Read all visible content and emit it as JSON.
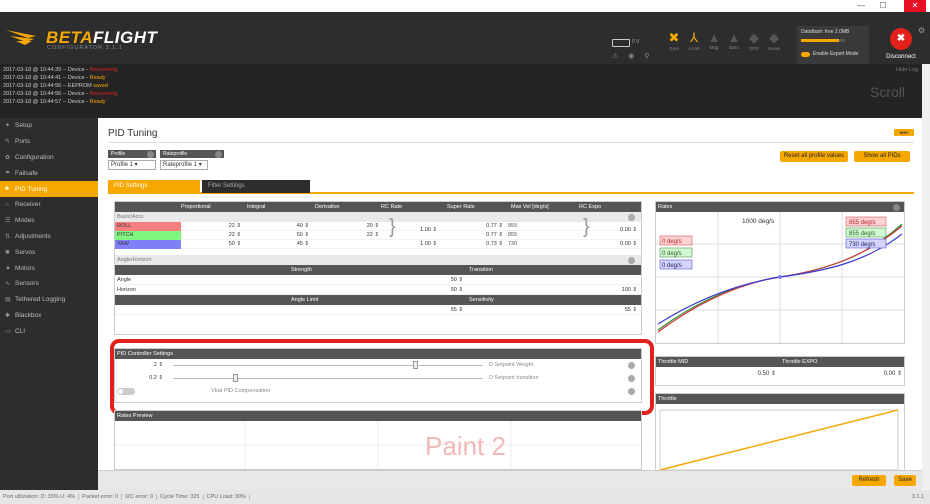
{
  "window": {
    "minimize": "—",
    "maximize": "☐",
    "close": "✕"
  },
  "header": {
    "logo_betaflight": "BETA",
    "logo_flight": "FLIGHT",
    "logo_sub": "CONFIGURATOR 3.1.1",
    "battery": "0 V",
    "sensors": [
      {
        "name": "Gyro",
        "glyph": "✖",
        "on": true
      },
      {
        "name": "Accel",
        "glyph": "⅄",
        "on": true
      },
      {
        "name": "Mag",
        "glyph": "▲",
        "on": false
      },
      {
        "name": "Baro",
        "glyph": "▲",
        "on": false
      },
      {
        "name": "GPS",
        "glyph": "◆",
        "on": false
      },
      {
        "name": "Sonar",
        "glyph": "◆",
        "on": false
      }
    ],
    "dataflash": "Dataflash: free 2.0MB",
    "dataflash_fraction": 0.86,
    "expert_mode": "Enable Expert Mode",
    "disconnect": "Disconnect"
  },
  "log": {
    "lines": [
      {
        "prefix": "2017-03-18 @ 10:44:39 -- Device - ",
        "status": "Recovering",
        "tone": "red"
      },
      {
        "prefix": "2017-03-18 @ 10:44:41 -- Device - ",
        "status": "Ready",
        "tone": "yellow"
      },
      {
        "prefix": "2017-03-18 @ 10:44:56 -- EEPROM ",
        "status": "saved",
        "tone": "yellow"
      },
      {
        "prefix": "2017-03-18 @ 10:44:56 -- Device - ",
        "status": "Recovering",
        "tone": "red"
      },
      {
        "prefix": "2017-03-18 @ 10:44:57 -- Device - ",
        "status": "Ready",
        "tone": "yellow"
      }
    ],
    "hide_log": "Hide Log",
    "scroll": "Scroll"
  },
  "nav": [
    {
      "label": "Setup",
      "icon": "✦",
      "active": false
    },
    {
      "label": "Ports",
      "icon": "✎",
      "active": false
    },
    {
      "label": "Configuration",
      "icon": "✿",
      "active": false
    },
    {
      "label": "Failsafe",
      "icon": "☂",
      "active": false
    },
    {
      "label": "PID Tuning",
      "icon": "♣",
      "active": true
    },
    {
      "label": "Receiver",
      "icon": "⌂",
      "active": false
    },
    {
      "label": "Modes",
      "icon": "☰",
      "active": false
    },
    {
      "label": "Adjustments",
      "icon": "⇅",
      "active": false
    },
    {
      "label": "Servos",
      "icon": "✺",
      "active": false
    },
    {
      "label": "Motors",
      "icon": "▲",
      "active": false
    },
    {
      "label": "Sensors",
      "icon": "∿",
      "active": false
    },
    {
      "label": "Tethered Logging",
      "icon": "▤",
      "active": false
    },
    {
      "label": "Blackbox",
      "icon": "✱",
      "active": false
    },
    {
      "label": "CLI",
      "icon": "▭",
      "active": false
    }
  ],
  "page": {
    "title": "PID Tuning",
    "wiki": "WIKI",
    "profile_label": "Profile",
    "profile_value": "Profile 1",
    "rateprofile_label": "Rateprofile",
    "rateprofile_value": "Rateprofile 1",
    "reset_button": "Reset all profile values",
    "show_all_button": "Show all PIDs",
    "tabs": [
      "PID Settings",
      "Filter Settings"
    ]
  },
  "pid_table": {
    "headers": [
      "Proportional",
      "Integral",
      "Derivative",
      "RC Rate",
      "Super Rate",
      "Max Vel [deg/s]",
      "RC Expo"
    ],
    "group_basic": "Basic/Acro",
    "rows": [
      {
        "axis": "ROLL",
        "color": "#f77f7f",
        "p": "22",
        "i": "40",
        "d": "20",
        "super": "0.77",
        "maxvel": "855"
      },
      {
        "axis": "PITCH",
        "color": "#7ff77f",
        "p": "22",
        "i": "50",
        "d": "22",
        "super": "0.77",
        "maxvel": "855"
      },
      {
        "axis": "YAW",
        "color": "#7f7ff7",
        "p": "50",
        "i": "45",
        "d": "",
        "super": "0.73",
        "maxvel": "730"
      }
    ],
    "rc_rate": "1.00",
    "rc_rate_yaw": "1.00",
    "rc_expo": "0.00",
    "rc_expo_yaw": "0.00",
    "group_angle": "Angle/Horizon",
    "strength_label": "Strength",
    "transition_label": "Transition",
    "angle_label": "Angle",
    "horizon_label": "Horizon",
    "angle_strength": "50",
    "horizon_strength": "50",
    "horizon_transition": "100",
    "angle_limit_label": "Angle Limit",
    "sensitivity_label": "Sensitivity",
    "angle_limit": "55",
    "sensitivity": "55"
  },
  "pid_controller": {
    "title": "PID Controller Settings",
    "rows": [
      {
        "value": "2",
        "label": "D Setpoint Weight",
        "fraction": 0.8
      },
      {
        "value": "0.2",
        "label": "D Setpoint transition",
        "fraction": 0.2
      }
    ],
    "vbat_label": "Vbat PID Compensation",
    "vbat_enabled": false
  },
  "rates_preview": {
    "title": "Rates Preview",
    "watermark": "Paint 2"
  },
  "rates": {
    "title": "Rates",
    "max_label": "1000 deg/s",
    "left_labels": [
      "0 deg/s",
      "0 deg/s",
      "0 deg/s"
    ],
    "right_labels": [
      "855 deg/s",
      "855 deg/s",
      "730 deg/s"
    ]
  },
  "throttle": {
    "mid_label": "Throttle MID",
    "expo_label": "Throttle EXPO",
    "mid": "0.50",
    "expo": "0.00",
    "curve_title": "Throttle"
  },
  "footer": {
    "refresh": "Refresh",
    "save": "Save"
  },
  "status": {
    "items": [
      "Port utilization: D: 33% U: 4%",
      "Packet error: 0",
      "I2C error: 0",
      "Cycle Time: 325",
      "CPU Load: 30%"
    ],
    "version": "3.1.1"
  }
}
